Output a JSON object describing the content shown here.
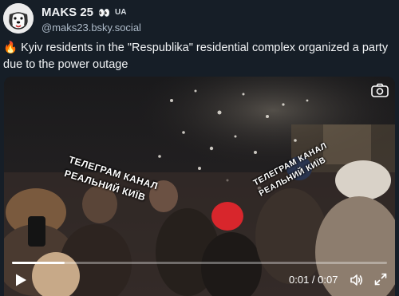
{
  "author": {
    "display_name": "MAKS 25",
    "eyes_icon": "👀",
    "badge": "UA",
    "handle": "@maks23.bsky.social"
  },
  "post": {
    "fire_icon": "🔥",
    "text": "Kyiv residents in the \"Respublika\" residential complex organized a party due to the power outage"
  },
  "video": {
    "watermark_left_line1": "ТЕЛЕГРАМ КАНАЛ",
    "watermark_left_line2": "РЕАЛЬНИЙ КИЇВ",
    "watermark_right_line1": "ТЕЛЕГРАМ КАНАЛ",
    "watermark_right_line2": "РЕАЛЬНИЙ КИЇВ",
    "current_time": "0:01",
    "duration": "0:07",
    "time_separator": " / ",
    "progress_fraction": 0.14
  },
  "icons": {
    "camera": "camera-icon",
    "play": "play-icon",
    "volume": "volume-icon",
    "fullscreen": "fullscreen-icon"
  }
}
